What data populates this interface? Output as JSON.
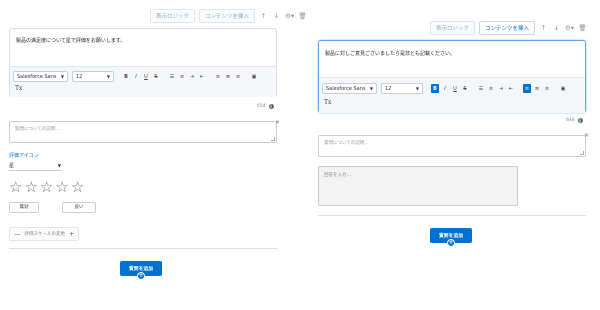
{
  "left": {
    "toolbar": {
      "logic_label": "表示ロジック",
      "insert_label": "コンテンツを挿入"
    },
    "question": "製品の満足度について星で評価をお願いします。",
    "editor": {
      "font_value": "Salesforce Sans",
      "size_value": "12",
      "formats": [
        "B",
        "I",
        "U",
        "S"
      ],
      "clear_format": "Tx"
    },
    "char_count": "654",
    "description_placeholder": "質問についての説明...",
    "rating_icon_label": "評価アイコン",
    "rating_icon_value": "星",
    "star_count": 5,
    "option_labels": [
      "無効",
      "良い"
    ],
    "scale_label": "評価スケールの変更",
    "add_question_label": "質問を追加"
  },
  "right": {
    "toolbar": {
      "logic_label": "表示ロジック",
      "insert_label": "コンテンツを挿入"
    },
    "question": "製品に対しご意見ございましたら是非とも記載ください。",
    "editor": {
      "font_value": "Salesforce Sans",
      "size_value": "12",
      "formats": [
        "B",
        "I",
        "U",
        "S"
      ],
      "clear_format": "Tx"
    },
    "char_count": "648",
    "description_placeholder": "質問についての説明...",
    "answer_placeholder": "回答を入力...",
    "add_question_label": "質問を追加"
  },
  "colors": {
    "accent": "#0070d2",
    "border": "#d8dde6"
  },
  "icons": {
    "up": "arrow-up-icon",
    "down": "arrow-down-icon",
    "settings": "gear-icon",
    "delete": "trash-icon",
    "close": "close-icon",
    "info": "info-icon",
    "plus": "plus-icon",
    "star": "star-icon"
  }
}
